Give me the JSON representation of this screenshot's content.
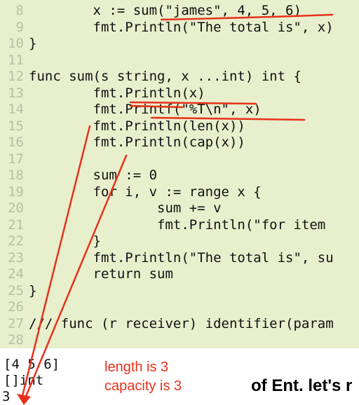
{
  "editor": {
    "lines": [
      {
        "num": "8",
        "text": "        x := sum(\"james\", 4, 5, 6)"
      },
      {
        "num": "9",
        "text": "        fmt.Println(\"The total is\", x)"
      },
      {
        "num": "10",
        "text": "}"
      },
      {
        "num": "11",
        "text": ""
      },
      {
        "num": "12",
        "text": "func sum(s string, x ...int) int {"
      },
      {
        "num": "13",
        "text": "        fmt.Println(x)"
      },
      {
        "num": "14",
        "text": "        fmt.Printf(\"%T\\n\", x)"
      },
      {
        "num": "15",
        "text": "        fmt.Println(len(x))"
      },
      {
        "num": "16",
        "text": "        fmt.Println(cap(x))"
      },
      {
        "num": "17",
        "text": ""
      },
      {
        "num": "18",
        "text": "        sum := 0"
      },
      {
        "num": "19",
        "text": "        for i, v := range x {"
      },
      {
        "num": "20",
        "text": "                sum += v"
      },
      {
        "num": "21",
        "text": "                fmt.Println(\"for item"
      },
      {
        "num": "22",
        "text": "        }"
      },
      {
        "num": "23",
        "text": "        fmt.Println(\"The total is\", su"
      },
      {
        "num": "24",
        "text": "        return sum"
      },
      {
        "num": "25",
        "text": "}"
      },
      {
        "num": "26",
        "text": ""
      },
      {
        "num": "27",
        "text": "/// func (r receiver) identifier(param"
      },
      {
        "num": "28",
        "text": ""
      }
    ]
  },
  "output": {
    "lines": [
      "[4 5 6]",
      "[]int",
      "3"
    ]
  },
  "annotations": {
    "length_note": "length is 3",
    "capacity_note": "capacity is 3",
    "color": "#e8301b"
  },
  "subtitle": "of Ent. let's r"
}
